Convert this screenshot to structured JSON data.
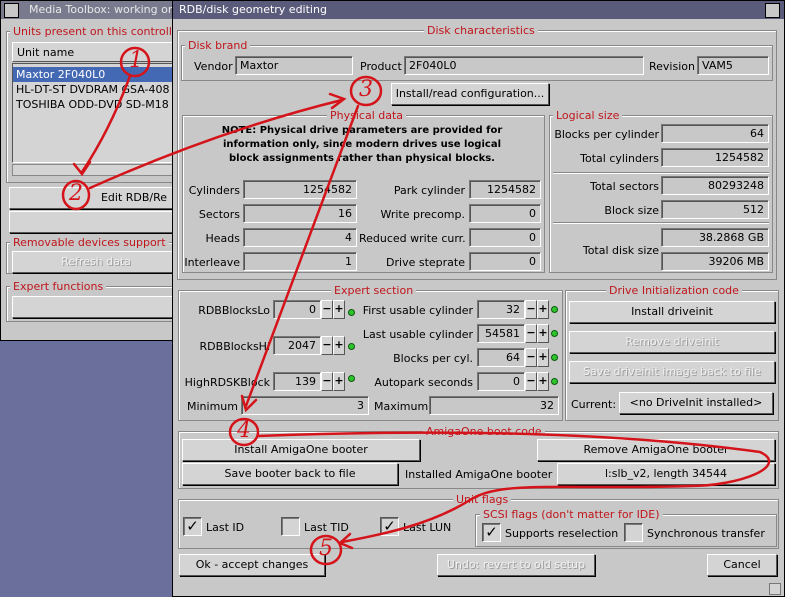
{
  "background_window": {
    "title": "Media Toolbox: working on",
    "units_group": "Units present on this controlle",
    "unit_name_header": "Unit name",
    "units": [
      "Maxtor 2F040L0",
      "HL-DT-ST DVDRAM GSA-408",
      "TOSHIBA  ODD-DVD SD-M18"
    ],
    "edit_button": "Edit RDB/Re",
    "removable_group": "Removable devices support",
    "refresh_button": "Refresh data",
    "expert_group": "Expert functions"
  },
  "window": {
    "title": "RDB/disk geometry editing",
    "disk_characteristics": "Disk characteristics",
    "disk_brand": {
      "title": "Disk brand",
      "vendor_label": "Vendor",
      "vendor": "Maxtor",
      "product_label": "Product",
      "product": "2F040L0",
      "revision_label": "Revision",
      "revision": "VAM5"
    },
    "install_read_button": "Install/read configuration...",
    "physical": {
      "title": "Physical data",
      "note": "NOTE: Physical drive parameters are provided for information only, since modern drives use logical block assignments rather than physical blocks.",
      "cylinders_label": "Cylinders",
      "cylinders": "1254582",
      "sectors_label": "Sectors",
      "sectors": "16",
      "heads_label": "Heads",
      "heads": "4",
      "interleave_label": "Interleave",
      "interleave": "1",
      "park_label": "Park cylinder",
      "park": "1254582",
      "precomp_label": "Write precomp.",
      "precomp": "0",
      "reduced_label": "Reduced write curr.",
      "reduced": "0",
      "steprate_label": "Drive steprate",
      "steprate": "0"
    },
    "logical": {
      "title": "Logical size",
      "bpc_label": "Blocks per cylinder",
      "bpc": "64",
      "total_cyl_label": "Total cylinders",
      "total_cyl": "1254582",
      "total_sectors_label": "Total sectors",
      "total_sectors": "80293248",
      "block_size_label": "Block size",
      "block_size": "512",
      "total_disk_label": "Total disk size",
      "total_gb": "38.2868 GB",
      "total_mb": "39206 MB"
    },
    "expert": {
      "title": "Expert section",
      "rdblo_label": "RDBBlocksLo",
      "rdblo": "0",
      "rdbhi_label": "RDBBlocksHi",
      "rdbhi": "2047",
      "highrdsk_label": "HighRDSKBlock",
      "highrdsk": "139",
      "first_cyl_label": "First usable cylinder",
      "first_cyl": "32",
      "last_cyl_label": "Last usable cylinder",
      "last_cyl": "54581",
      "bpc_label": "Blocks per cyl.",
      "bpc": "64",
      "autopark_label": "Autopark seconds",
      "autopark": "0",
      "minimum_label": "Minimum",
      "minimum": "3",
      "maximum_label": "Maximum",
      "maximum": "32",
      "minus": "−",
      "plus": "+"
    },
    "driveinit": {
      "title": "Drive Initialization code",
      "install": "Install driveinit",
      "remove": "Remove driveinit",
      "save": "Save driveinit image back to file",
      "current_label": "Current:",
      "current": "<no DriveInit installed>"
    },
    "amigaone": {
      "title": "AmigaOne boot code",
      "install": "Install AmigaOne booter",
      "remove": "Remove AmigaOne booter",
      "save": "Save booter back to file",
      "installed_label": "Installed AmigaOne booter",
      "installed": "l:slb_v2, length 34544"
    },
    "unit_flags": {
      "title": "Unit flags",
      "last_id": "Last ID",
      "last_id_checked": true,
      "last_tid": "Last TID",
      "last_tid_checked": false,
      "last_lun": "Last LUN",
      "last_lun_checked": true
    },
    "scsi_flags": {
      "title": "SCSI flags (don't matter for IDE)",
      "reselection": "Supports reselection",
      "reselection_checked": true,
      "sync": "Synchronous transfer",
      "sync_checked": false
    },
    "ok_button": "Ok - accept changes",
    "undo_button": "Undo: revert to old setup",
    "cancel_button": "Cancel"
  },
  "annotations": [
    "1",
    "2",
    "3",
    "4",
    "5"
  ],
  "colors": {
    "group_title": "#c0151b",
    "annotation": "#d4141a",
    "selection": "#4469b4",
    "led": "#2ec42e"
  }
}
